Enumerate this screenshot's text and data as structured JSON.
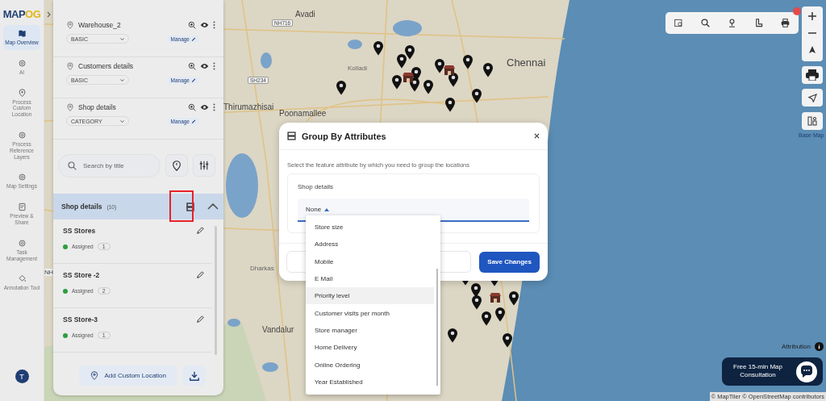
{
  "logo": {
    "part_1": "MAP",
    "part_2": "OG"
  },
  "nav": [
    {
      "label": "Map Overview",
      "kind": "map",
      "selected": true
    },
    {
      "label": "AI",
      "kind": "gear",
      "selected": false
    },
    {
      "label": "Process Custom Location",
      "kind": "pin",
      "selected": false
    },
    {
      "label": "Process Reference Layers",
      "kind": "gear",
      "selected": false
    },
    {
      "label": "Map Settings",
      "kind": "gear",
      "selected": false
    },
    {
      "label": "Preview & Share",
      "kind": "doc",
      "selected": false
    },
    {
      "label": "Task Management",
      "kind": "gear",
      "selected": false
    },
    {
      "label": "Annotation Tool",
      "kind": "bucket",
      "selected": false
    }
  ],
  "avatar": "T",
  "layers": [
    {
      "name": "Warehouse_2",
      "style": "BASIC",
      "manage": "Manage"
    },
    {
      "name": "Customers details",
      "style": "BASIC",
      "manage": "Manage"
    },
    {
      "name": "Shop details",
      "style": "CATEGORY",
      "manage": "Manage"
    }
  ],
  "search": {
    "placeholder": "Search by title"
  },
  "group": {
    "title": "Shop details",
    "count": "(10)"
  },
  "items": [
    {
      "name": "SS Stores",
      "status": "Assigned",
      "count": "1",
      "color": "#2e9e3e"
    },
    {
      "name": "SS Store -2",
      "status": "Assigned",
      "count": "2",
      "color": "#2e9e3e"
    },
    {
      "name": "SS Store-3",
      "status": "Assigned",
      "count": "1",
      "color": "#2e9e3e"
    }
  ],
  "add_button": "Add Custom Location",
  "map_labels": [
    {
      "text": "Avadi",
      "kind": "town"
    },
    {
      "text": "NH716",
      "kind": "road"
    },
    {
      "text": "Kolladi",
      "kind": "place"
    },
    {
      "text": "SH234",
      "kind": "road"
    },
    {
      "text": "Thirumazhisai",
      "kind": "town"
    },
    {
      "text": "Poonamallee",
      "kind": "town"
    },
    {
      "text": "Chennai",
      "kind": "city"
    },
    {
      "text": "Dharkas",
      "kind": "place"
    },
    {
      "text": "Vandalur",
      "kind": "town"
    },
    {
      "text": "NH",
      "kind": "road"
    }
  ],
  "base_map": "Base Map",
  "attribution": "Attribution",
  "consultation": "Free 15-min Map Consultation",
  "copyright": "© MapTiler © OpenStreetMap contributors",
  "dialog": {
    "title": "Group By Attributes",
    "description": "Select the feature attribute by which you need to group the locations",
    "layer": "Shop details",
    "value": "None",
    "save": "Save Changes",
    "options": [
      {
        "label": "Store size",
        "selected": false
      },
      {
        "label": "Address",
        "selected": false
      },
      {
        "label": "Mobile",
        "selected": false
      },
      {
        "label": "E Mail",
        "selected": false
      },
      {
        "label": "Priority level",
        "selected": true
      },
      {
        "label": "Customer visits per month",
        "selected": false
      },
      {
        "label": "Store manager",
        "selected": false
      },
      {
        "label": "Home Delivery",
        "selected": false
      },
      {
        "label": "Online Ordering",
        "selected": false
      },
      {
        "label": "Year Established",
        "selected": false
      }
    ]
  }
}
